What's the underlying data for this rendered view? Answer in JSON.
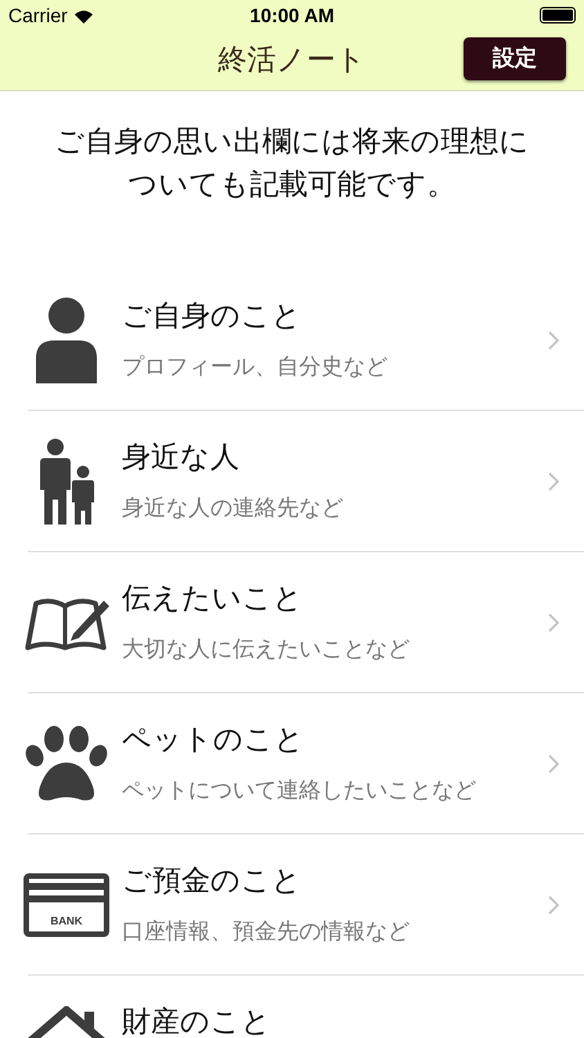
{
  "status_bar": {
    "carrier": "Carrier",
    "time": "10:00 AM"
  },
  "nav_bar": {
    "title": "終活ノート",
    "settings_button": "設定"
  },
  "intro": "ご自身の思い出欄には将来の理想についても記載可能です。",
  "items": [
    {
      "kind": "person",
      "title": "ご自身のこと",
      "subtitle": "プロフィール、自分史など"
    },
    {
      "kind": "family",
      "title": "身近な人",
      "subtitle": "身近な人の連絡先など"
    },
    {
      "kind": "book",
      "title": "伝えたいこと",
      "subtitle": "大切な人に伝えたいことなど"
    },
    {
      "kind": "paw",
      "title": "ペットのこと",
      "subtitle": "ペットについて連絡したいことなど"
    },
    {
      "kind": "card",
      "icon_text": "BANK",
      "title": "ご預金のこと",
      "subtitle": "口座情報、預金先の情報など"
    },
    {
      "kind": "house",
      "title": "財産のこと"
    }
  ]
}
